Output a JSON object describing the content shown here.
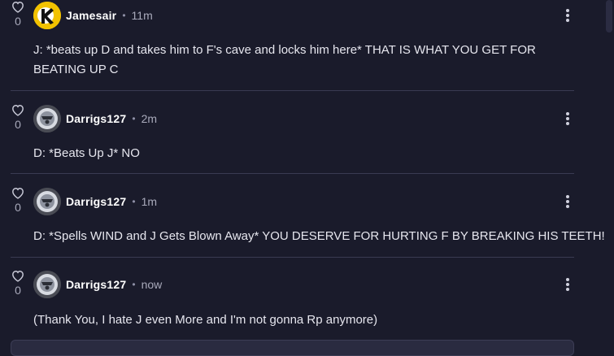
{
  "comments": [
    {
      "likes": "0",
      "author": "Jamesair",
      "separator": "•",
      "time": "11m",
      "text": "J: *beats up D and takes him to F's cave and locks him here* THAT IS WHAT YOU GET FOR BEATING UP C"
    },
    {
      "likes": "0",
      "author": "Darrigs127",
      "separator": "•",
      "time": "2m",
      "text": "D: *Beats Up J* NO"
    },
    {
      "likes": "0",
      "author": "Darrigs127",
      "separator": "•",
      "time": "1m",
      "text": "D: *Spells WIND and J Gets Blown Away* YOU DESERVE FOR HURTING F BY BREAKING HIS TEETH!"
    },
    {
      "likes": "0",
      "author": "Darrigs127",
      "separator": "•",
      "time": "now",
      "text": "(Thank You, I hate J even More and I'm not gonna Rp anymore)"
    }
  ],
  "icons": {
    "like": "heart-icon",
    "menu": "more-vertical-icon"
  },
  "colors": {
    "background": "#1a1b2b",
    "divider": "#3a3b52",
    "text": "#e6e6ee",
    "muted": "#a9aabb",
    "jamesair_avatar": "#f2c200"
  }
}
